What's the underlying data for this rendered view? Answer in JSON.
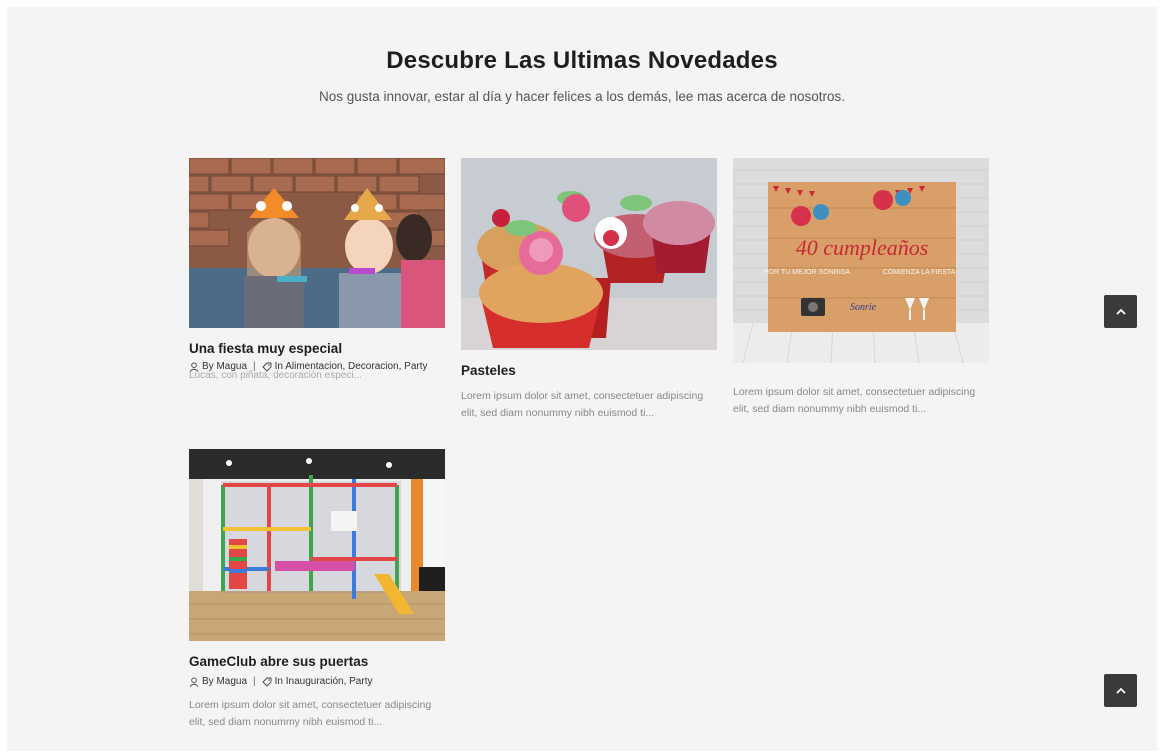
{
  "section": {
    "title": "Descubre Las Ultimas Novedades",
    "subtitle": "Nos gusta innovar, estar al día y hacer felices a los demás, lee mas acerca de nosotros."
  },
  "posts": [
    {
      "title": "Una fiesta muy especial",
      "author": "By Magua",
      "categories": "In Alimentacion, Decoracion, Party",
      "ghost_excerpt": "Lucas, con piñata, decoración especi..."
    },
    {
      "title": "Pasteles",
      "excerpt": "Lorem ipsum dolor sit amet, consectetuer adipiscing elit, sed diam nonummy nibh euismod ti..."
    },
    {
      "poster_lines": [
        "40 cumpleaños",
        "POR TU MEJOR SONRISA",
        "COMIENZA LA FIESTA",
        "Sonrie"
      ],
      "excerpt": "Lorem ipsum dolor sit amet, consectetuer adipiscing elit, sed diam nonummy nibh euismod ti..."
    },
    {
      "title": "GameClub abre sus puertas",
      "author": "By Magua",
      "categories": "In Inauguración, Party",
      "excerpt": "Lorem ipsum dolor sit amet, consectetuer adipiscing elit, sed diam nonummy nibh euismod ti..."
    }
  ],
  "icons": {
    "author": "user-icon",
    "category": "tag-icon",
    "scroll": "chevron-up-icon"
  },
  "colors": {
    "panel_bg": "#f4f4f4",
    "scroll_button": "#3a3a3a",
    "poster_red": "#c8283a"
  }
}
